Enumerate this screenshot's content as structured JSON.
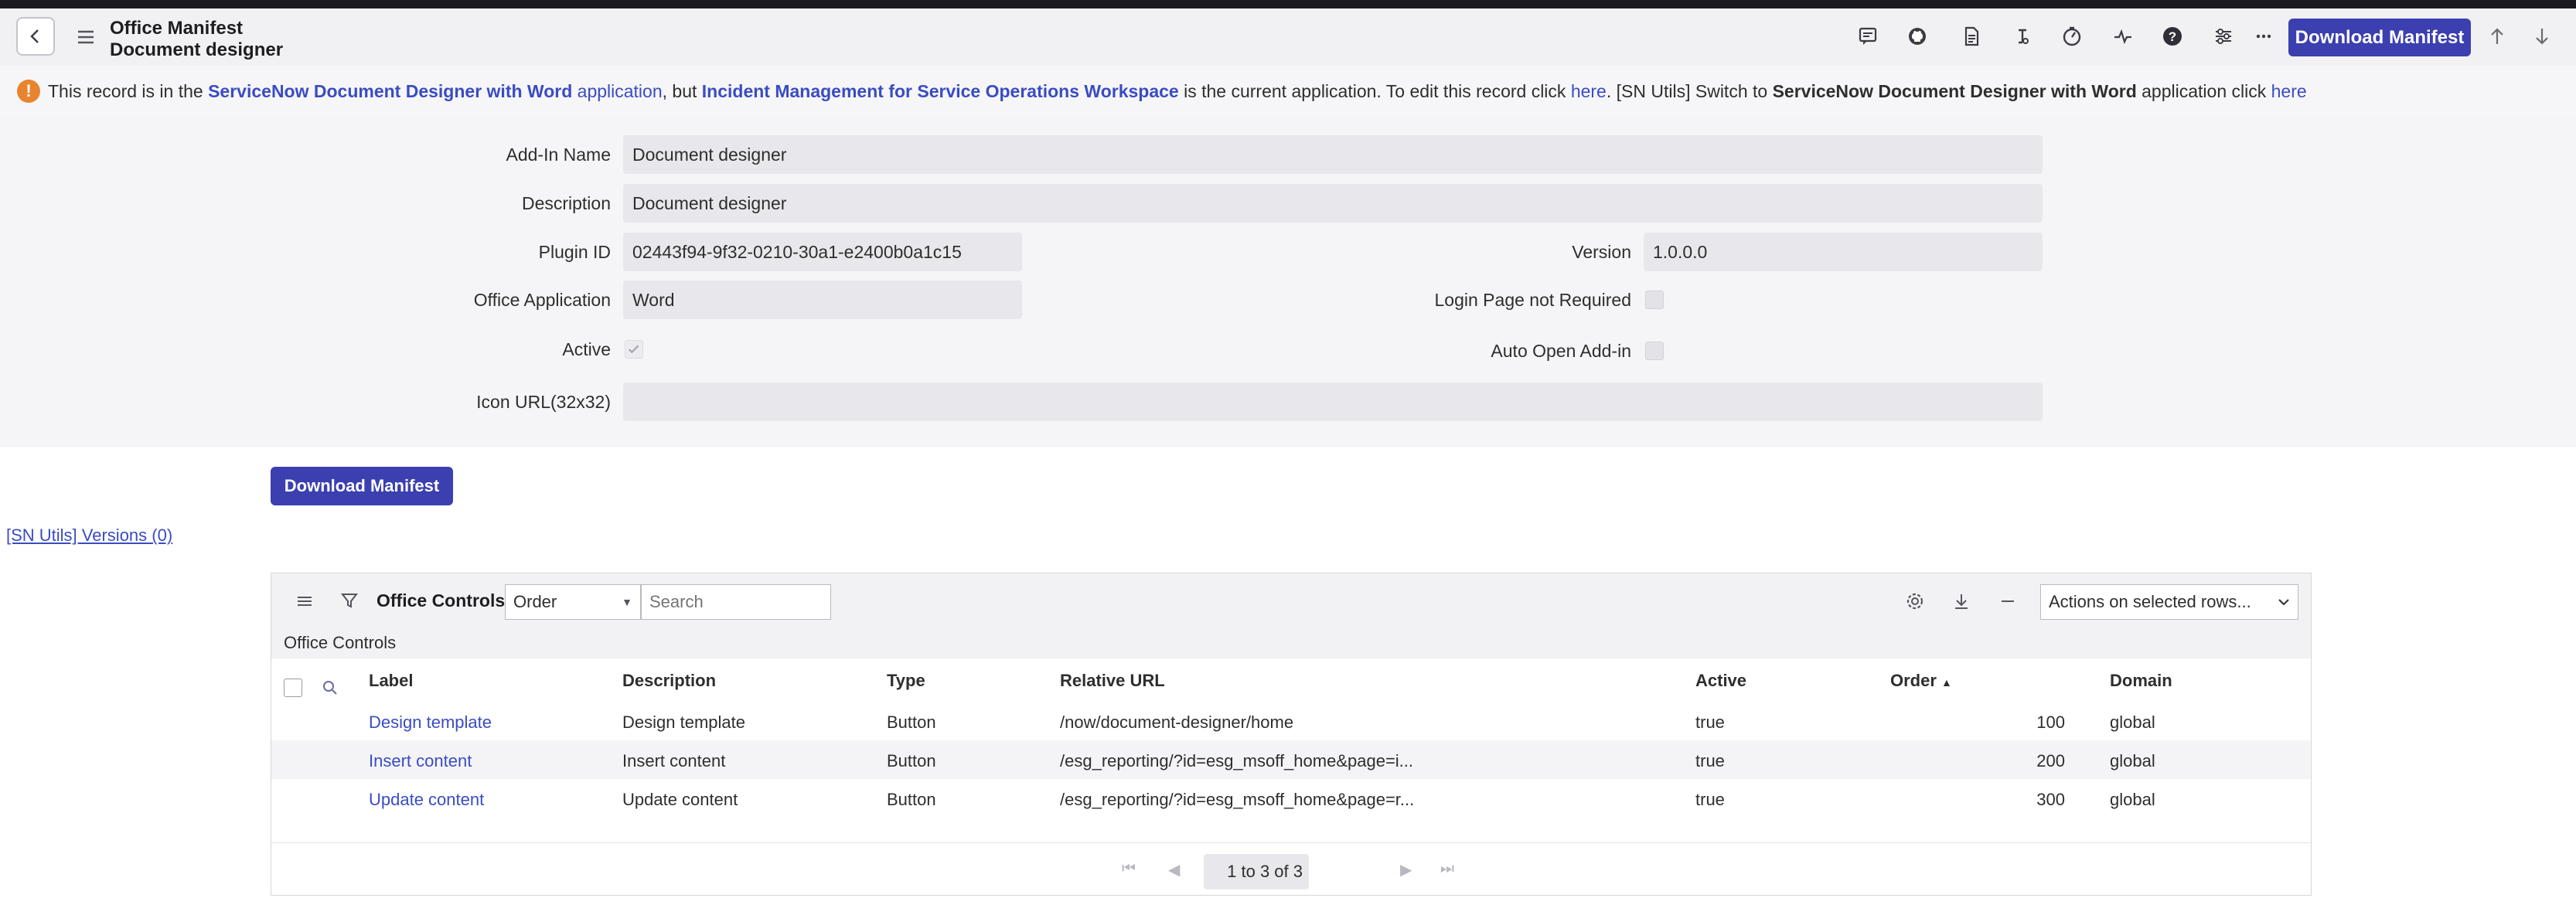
{
  "header": {
    "title": "Office Manifest",
    "subtitle": "Document designer",
    "download_label": "Download Manifest"
  },
  "infobar": {
    "p1": "This record is in the ",
    "app_link": "ServiceNow Document Designer with Word",
    "app_word": " application",
    "p2": ", but ",
    "current_app": "Incident Management for Service Operations Workspace",
    "p3": " is the current application. To edit this record click ",
    "here1": "here",
    "p4": ".  [SN Utils] Switch to ",
    "switch_app": "ServiceNow Document Designer with Word",
    "p5": " application click ",
    "here2": "here"
  },
  "form": {
    "addin_name_label": "Add-In Name",
    "addin_name_value": "Document designer",
    "description_label": "Description",
    "description_value": "Document designer",
    "plugin_id_label": "Plugin ID",
    "plugin_id_value": "02443f94-9f32-0210-30a1-e2400b0a1c15",
    "version_label": "Version",
    "version_value": "1.0.0.0",
    "office_app_label": "Office Application",
    "office_app_value": "Word",
    "login_label": "Login Page not Required",
    "active_label": "Active",
    "auto_open_label": "Auto Open Add-in",
    "icon_url_label": "Icon URL(32x32)",
    "icon_url_value": "",
    "download_label": "Download Manifest"
  },
  "versions_link": "[SN Utils] Versions (0)",
  "related": {
    "title": "Office Controls",
    "sort_select": "Order",
    "search_placeholder": "Search",
    "actions_select": "Actions on selected rows...",
    "sub_title": "Office Controls",
    "columns": {
      "label": "Label",
      "description": "Description",
      "type": "Type",
      "url": "Relative URL",
      "active": "Active",
      "order": "Order",
      "domain": "Domain"
    },
    "rows": [
      {
        "label": "Design template",
        "description": "Design template",
        "type": "Button",
        "url": "/now/document-designer/home",
        "active": "true",
        "order": "100",
        "domain": "global"
      },
      {
        "label": "Insert content",
        "description": "Insert content",
        "type": "Button",
        "url": "/esg_reporting/?id=esg_msoff_home&page=i...",
        "active": "true",
        "order": "200",
        "domain": "global"
      },
      {
        "label": "Update content",
        "description": "Update content",
        "type": "Button",
        "url": "/esg_reporting/?id=esg_msoff_home&page=r...",
        "active": "true",
        "order": "300",
        "domain": "global"
      }
    ],
    "pager_page": "1",
    "pager_text": "to 3 of 3"
  },
  "icons": {
    "header": [
      "back-icon",
      "hamburger-icon",
      "comment-icon",
      "github-icon",
      "document-icon",
      "attachment-icon",
      "activity-icon",
      "pulse-icon",
      "help-icon",
      "settings-sliders-icon",
      "more-icon",
      "arrow-up-icon",
      "arrow-down-icon"
    ]
  },
  "colors": {
    "accent": "#3b3fb0",
    "link": "#3a4cc2",
    "warning": "#e8842f"
  }
}
